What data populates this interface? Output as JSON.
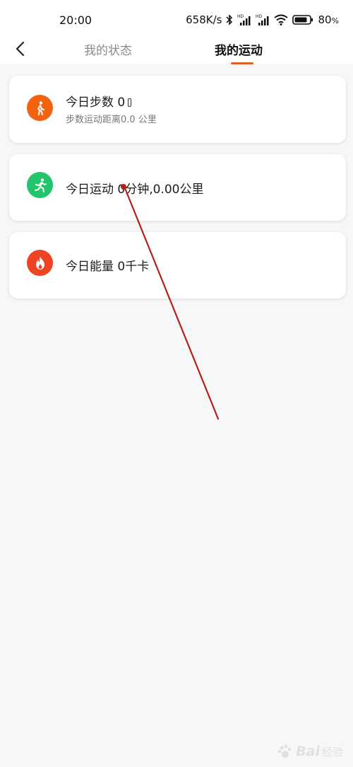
{
  "status_bar": {
    "time": "20:00",
    "net_speed": "658K/s",
    "battery_percent": "80",
    "battery_unit": "%",
    "icons": [
      "bluetooth-icon",
      "hd-signal-icon",
      "hd-signal-icon",
      "wifi-icon",
      "battery-icon"
    ]
  },
  "nav": {
    "back_icon": "chevron-left-icon",
    "tabs": [
      {
        "label": "我的状态",
        "active": false
      },
      {
        "label": "我的运动",
        "active": true
      }
    ],
    "accent": "#e0612a"
  },
  "cards": [
    {
      "icon": "walking-icon",
      "color": "#f2620f",
      "title": "今日步数 0",
      "subtitle": "步数运动距离0.0 公里"
    },
    {
      "icon": "running-icon",
      "color": "#22c56b",
      "title": "今日运动 0分钟,0.00公里"
    },
    {
      "icon": "flame-icon",
      "color": "#ef4423",
      "title": "今日能量 0千卡"
    }
  ],
  "watermark": {
    "brand": "Bai",
    "cn": "经验"
  }
}
